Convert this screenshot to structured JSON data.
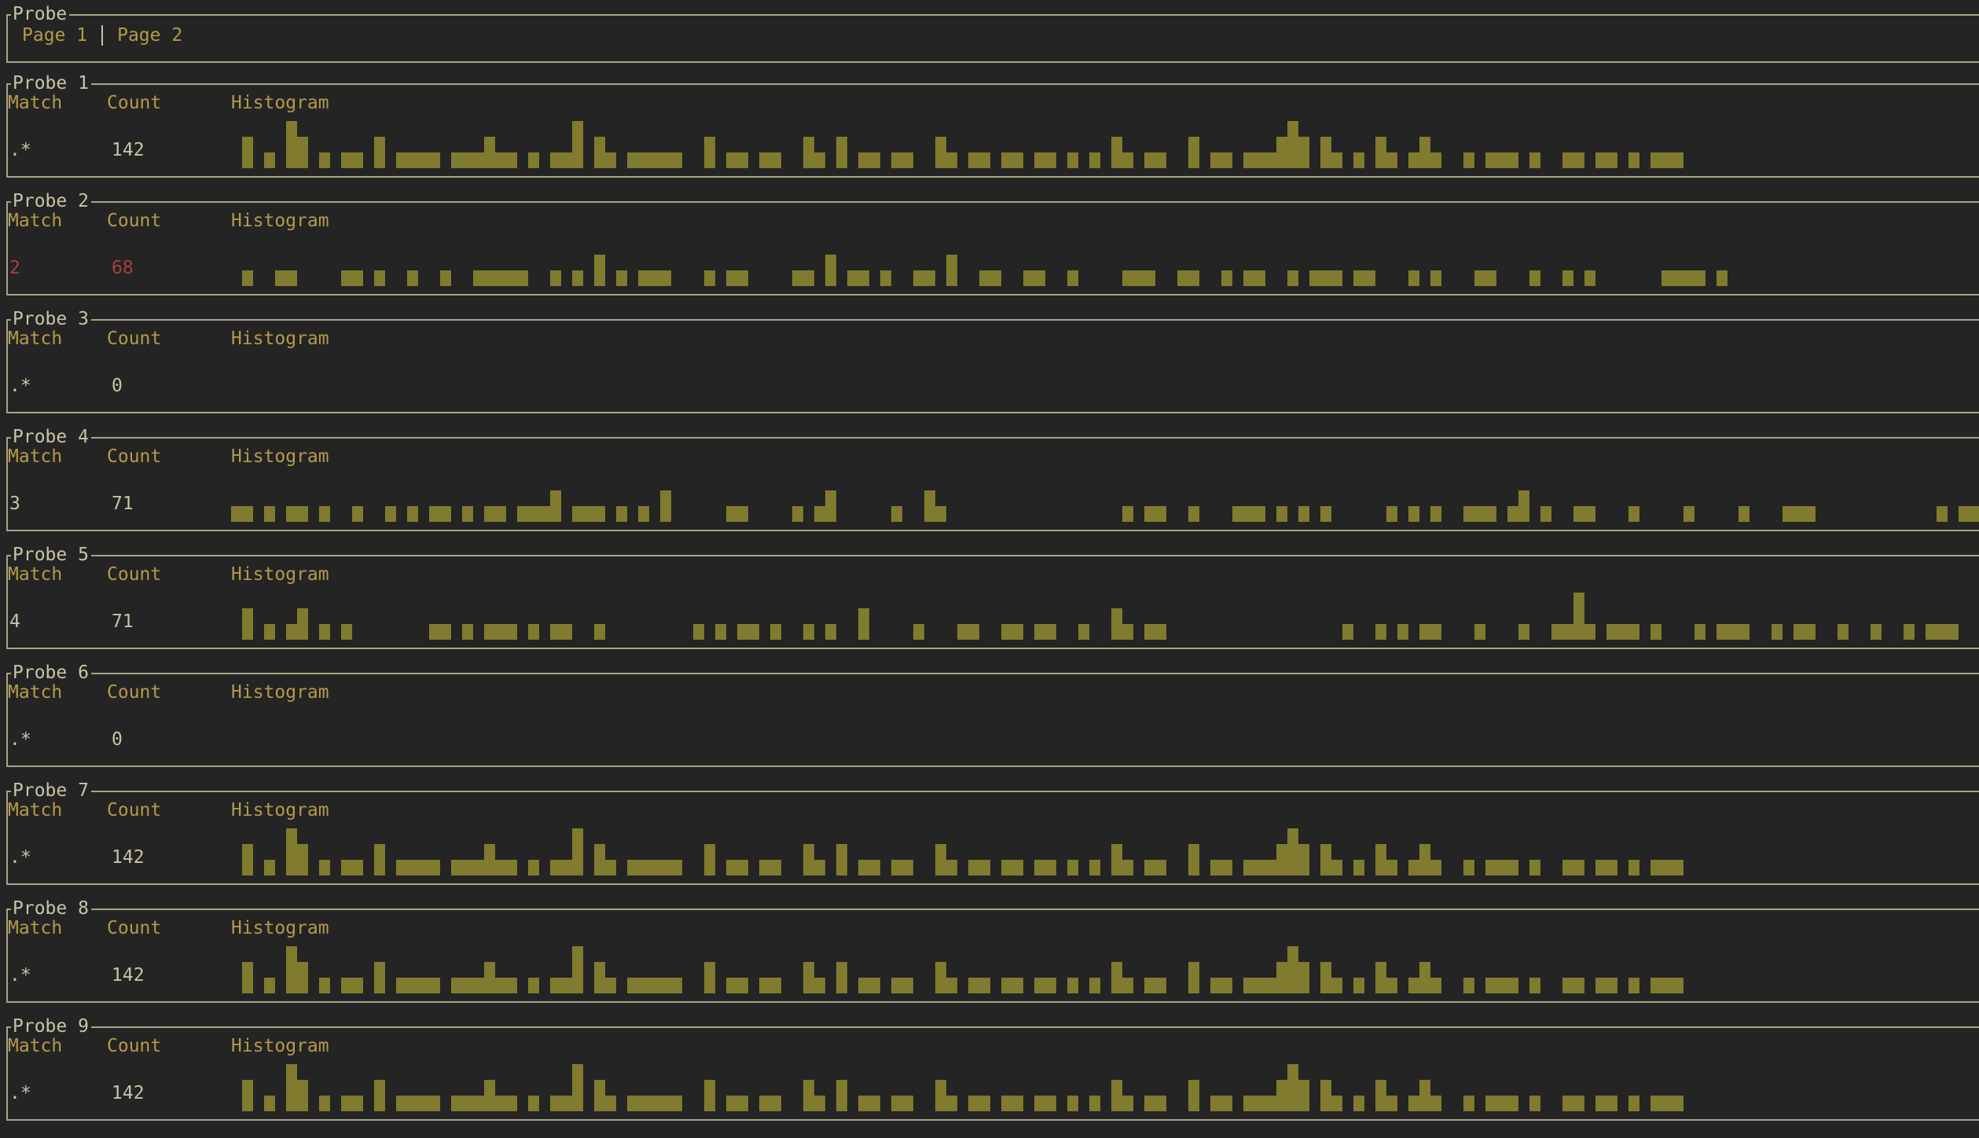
{
  "header": {
    "title": "Probe",
    "tabs": [
      {
        "label": "Page 1"
      },
      {
        "label": "Page 2"
      }
    ]
  },
  "columns": {
    "match": "Match",
    "count": "Count",
    "histogram": "Histogram"
  },
  "colors": {
    "bar": "#807b2e",
    "label": "#b59a4a",
    "highlight": "#a8403a",
    "border": "#a8a389",
    "background": "#242424"
  },
  "probes": [
    {
      "title": "Probe 1",
      "match": ".*",
      "count": "142",
      "highlighted": false,
      "histogram": [
        0,
        2,
        0,
        1,
        0,
        3,
        2,
        0,
        1,
        0,
        1,
        1,
        0,
        2,
        0,
        1,
        1,
        1,
        1,
        0,
        1,
        1,
        1,
        2,
        1,
        1,
        0,
        1,
        0,
        1,
        1,
        3,
        0,
        2,
        1,
        0,
        1,
        1,
        1,
        1,
        1,
        0,
        0,
        2,
        0,
        1,
        1,
        0,
        1,
        1,
        0,
        0,
        2,
        1,
        0,
        2,
        0,
        1,
        1,
        0,
        1,
        1,
        0,
        0,
        2,
        1,
        0,
        1,
        1,
        0,
        1,
        1,
        0,
        1,
        1,
        0,
        1,
        0,
        1,
        0,
        2,
        1,
        0,
        1,
        1,
        0,
        0,
        2,
        0,
        1,
        1,
        0,
        1,
        1,
        1,
        2,
        3,
        2,
        0,
        2,
        1,
        0,
        1,
        0,
        2,
        1,
        0,
        1,
        2,
        1,
        0,
        0,
        1,
        0,
        1,
        1,
        1,
        0,
        1,
        0,
        0,
        1,
        1,
        0,
        1,
        1,
        0,
        1,
        0,
        1,
        1,
        1
      ]
    },
    {
      "title": "Probe 2",
      "match": "2",
      "count": "68",
      "highlighted": true,
      "histogram": [
        0,
        1,
        0,
        0,
        1,
        1,
        0,
        0,
        0,
        0,
        1,
        1,
        0,
        1,
        0,
        0,
        1,
        0,
        0,
        1,
        0,
        0,
        1,
        1,
        1,
        1,
        1,
        0,
        0,
        1,
        0,
        1,
        0,
        2,
        0,
        1,
        0,
        1,
        1,
        1,
        0,
        0,
        0,
        1,
        0,
        1,
        1,
        0,
        0,
        0,
        0,
        1,
        1,
        0,
        2,
        0,
        1,
        1,
        0,
        1,
        0,
        0,
        1,
        1,
        0,
        2,
        0,
        0,
        1,
        1,
        0,
        0,
        1,
        1,
        0,
        0,
        1,
        0,
        0,
        0,
        0,
        1,
        1,
        1,
        0,
        0,
        1,
        1,
        0,
        0,
        1,
        0,
        1,
        1,
        0,
        0,
        1,
        0,
        1,
        1,
        1,
        0,
        1,
        1,
        0,
        0,
        0,
        1,
        0,
        1,
        0,
        0,
        0,
        1,
        1,
        0,
        0,
        0,
        1,
        0,
        0,
        1,
        0,
        1,
        0,
        0,
        0,
        0,
        0,
        0,
        1,
        1,
        1,
        1,
        0,
        1
      ]
    },
    {
      "title": "Probe 3",
      "match": ".*",
      "count": "0",
      "highlighted": false,
      "histogram": []
    },
    {
      "title": "Probe 4",
      "match": "3",
      "count": "71",
      "highlighted": false,
      "histogram": [
        1,
        1,
        0,
        1,
        0,
        1,
        1,
        0,
        1,
        0,
        0,
        1,
        0,
        0,
        1,
        0,
        1,
        0,
        1,
        1,
        0,
        1,
        0,
        1,
        1,
        0,
        1,
        1,
        1,
        2,
        0,
        1,
        1,
        1,
        0,
        1,
        0,
        1,
        0,
        2,
        0,
        0,
        0,
        0,
        0,
        1,
        1,
        0,
        0,
        0,
        0,
        1,
        0,
        1,
        2,
        0,
        0,
        0,
        0,
        0,
        1,
        0,
        0,
        2,
        1,
        0,
        0,
        0,
        0,
        0,
        0,
        0,
        0,
        0,
        0,
        0,
        0,
        0,
        0,
        0,
        0,
        1,
        0,
        1,
        1,
        0,
        0,
        1,
        0,
        0,
        0,
        1,
        1,
        1,
        0,
        1,
        0,
        1,
        0,
        1,
        0,
        0,
        0,
        0,
        0,
        1,
        0,
        1,
        0,
        1,
        0,
        0,
        1,
        1,
        1,
        0,
        1,
        2,
        0,
        1,
        0,
        0,
        1,
        1,
        0,
        0,
        0,
        1,
        0,
        0,
        0,
        0,
        1,
        0,
        0,
        0,
        0,
        1,
        0,
        0,
        0,
        1,
        1,
        1,
        0,
        0,
        0,
        0,
        0,
        0,
        0,
        0,
        0,
        0,
        0,
        1,
        0,
        1,
        1
      ]
    },
    {
      "title": "Probe 5",
      "match": "4",
      "count": "71",
      "highlighted": false,
      "histogram": [
        0,
        2,
        0,
        1,
        0,
        1,
        2,
        0,
        1,
        0,
        1,
        0,
        0,
        0,
        0,
        0,
        0,
        0,
        1,
        1,
        0,
        1,
        0,
        1,
        1,
        1,
        0,
        1,
        0,
        1,
        1,
        0,
        0,
        1,
        0,
        0,
        0,
        0,
        0,
        0,
        0,
        0,
        1,
        0,
        1,
        0,
        1,
        1,
        0,
        1,
        0,
        0,
        1,
        0,
        1,
        0,
        0,
        2,
        0,
        0,
        0,
        0,
        1,
        0,
        0,
        0,
        1,
        1,
        0,
        0,
        1,
        1,
        0,
        1,
        1,
        0,
        0,
        1,
        0,
        0,
        2,
        1,
        0,
        1,
        1,
        0,
        0,
        0,
        0,
        0,
        0,
        0,
        0,
        0,
        0,
        0,
        0,
        0,
        0,
        0,
        0,
        1,
        0,
        0,
        1,
        0,
        1,
        0,
        1,
        1,
        0,
        0,
        0,
        1,
        0,
        0,
        0,
        1,
        0,
        0,
        1,
        1,
        3,
        1,
        0,
        1,
        1,
        1,
        0,
        1,
        0,
        0,
        0,
        1,
        0,
        1,
        1,
        1,
        0,
        0,
        1,
        0,
        1,
        1,
        0,
        0,
        1,
        0,
        0,
        1,
        0,
        0,
        1,
        0,
        1,
        1,
        1
      ]
    },
    {
      "title": "Probe 6",
      "match": ".*",
      "count": "0",
      "highlighted": false,
      "histogram": []
    },
    {
      "title": "Probe 7",
      "match": ".*",
      "count": "142",
      "highlighted": false,
      "histogram": [
        0,
        2,
        0,
        1,
        0,
        3,
        2,
        0,
        1,
        0,
        1,
        1,
        0,
        2,
        0,
        1,
        1,
        1,
        1,
        0,
        1,
        1,
        1,
        2,
        1,
        1,
        0,
        1,
        0,
        1,
        1,
        3,
        0,
        2,
        1,
        0,
        1,
        1,
        1,
        1,
        1,
        0,
        0,
        2,
        0,
        1,
        1,
        0,
        1,
        1,
        0,
        0,
        2,
        1,
        0,
        2,
        0,
        1,
        1,
        0,
        1,
        1,
        0,
        0,
        2,
        1,
        0,
        1,
        1,
        0,
        1,
        1,
        0,
        1,
        1,
        0,
        1,
        0,
        1,
        0,
        2,
        1,
        0,
        1,
        1,
        0,
        0,
        2,
        0,
        1,
        1,
        0,
        1,
        1,
        1,
        2,
        3,
        2,
        0,
        2,
        1,
        0,
        1,
        0,
        2,
        1,
        0,
        1,
        2,
        1,
        0,
        0,
        1,
        0,
        1,
        1,
        1,
        0,
        1,
        0,
        0,
        1,
        1,
        0,
        1,
        1,
        0,
        1,
        0,
        1,
        1,
        1
      ]
    },
    {
      "title": "Probe 8",
      "match": ".*",
      "count": "142",
      "highlighted": false,
      "histogram": [
        0,
        2,
        0,
        1,
        0,
        3,
        2,
        0,
        1,
        0,
        1,
        1,
        0,
        2,
        0,
        1,
        1,
        1,
        1,
        0,
        1,
        1,
        1,
        2,
        1,
        1,
        0,
        1,
        0,
        1,
        1,
        3,
        0,
        2,
        1,
        0,
        1,
        1,
        1,
        1,
        1,
        0,
        0,
        2,
        0,
        1,
        1,
        0,
        1,
        1,
        0,
        0,
        2,
        1,
        0,
        2,
        0,
        1,
        1,
        0,
        1,
        1,
        0,
        0,
        2,
        1,
        0,
        1,
        1,
        0,
        1,
        1,
        0,
        1,
        1,
        0,
        1,
        0,
        1,
        0,
        2,
        1,
        0,
        1,
        1,
        0,
        0,
        2,
        0,
        1,
        1,
        0,
        1,
        1,
        1,
        2,
        3,
        2,
        0,
        2,
        1,
        0,
        1,
        0,
        2,
        1,
        0,
        1,
        2,
        1,
        0,
        0,
        1,
        0,
        1,
        1,
        1,
        0,
        1,
        0,
        0,
        1,
        1,
        0,
        1,
        1,
        0,
        1,
        0,
        1,
        1,
        1
      ]
    },
    {
      "title": "Probe 9",
      "match": ".*",
      "count": "142",
      "highlighted": false,
      "histogram": [
        0,
        2,
        0,
        1,
        0,
        3,
        2,
        0,
        1,
        0,
        1,
        1,
        0,
        2,
        0,
        1,
        1,
        1,
        1,
        0,
        1,
        1,
        1,
        2,
        1,
        1,
        0,
        1,
        0,
        1,
        1,
        3,
        0,
        2,
        1,
        0,
        1,
        1,
        1,
        1,
        1,
        0,
        0,
        2,
        0,
        1,
        1,
        0,
        1,
        1,
        0,
        0,
        2,
        1,
        0,
        2,
        0,
        1,
        1,
        0,
        1,
        1,
        0,
        0,
        2,
        1,
        0,
        1,
        1,
        0,
        1,
        1,
        0,
        1,
        1,
        0,
        1,
        0,
        1,
        0,
        2,
        1,
        0,
        1,
        1,
        0,
        0,
        2,
        0,
        1,
        1,
        0,
        1,
        1,
        1,
        2,
        3,
        2,
        0,
        2,
        1,
        0,
        1,
        0,
        2,
        1,
        0,
        1,
        2,
        1,
        0,
        0,
        1,
        0,
        1,
        1,
        1,
        0,
        1,
        0,
        0,
        1,
        1,
        0,
        1,
        1,
        0,
        1,
        0,
        1,
        1,
        1
      ]
    }
  ]
}
